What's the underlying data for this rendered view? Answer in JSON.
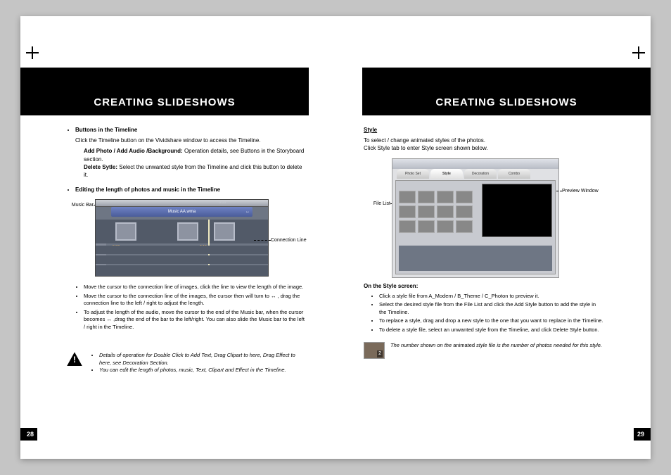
{
  "header_title": "CREATING SLIDESHOWS",
  "left": {
    "page_number": "28",
    "section1_title": "Buttons in the Timeline",
    "section1_intro": "Click the Timeline button on the Vividshare window to access the Timeline.",
    "section1_add_label": "Add Photo / Add Audio /Background:",
    "section1_add_text": " Operation details, see Buttons in the Storyboard section.",
    "section1_del_label": "Delete Sytle:",
    "section1_del_text": " Select the unwanted style from the Timeline and click this button to delete it.",
    "section2_title": "Editing the length of photos and music in the Timeline",
    "fig": {
      "music_bar_label": "Music Bar",
      "connection_label": "Connection Line",
      "music_file": "Music AA.wma",
      "time_left": "0:07",
      "time_right": "0:10",
      "time_top": "0:03"
    },
    "bullets": [
      "Move the cursor to the connection line of images, click the line to view the length of the image.",
      "Move the cursor to the connection line of the images, the cursor then will turn to ↔ , drag the connection line to the left / right to adjust the length.",
      "To adjust the length of the audio, move the cursor to the end of the Music bar, when the cursor becomes ↔ ,drag the end of the bar to the left/right. You can also slide the Music bar to the left / right in the Timeline."
    ],
    "notes": [
      "Details of operation for Double Click to Add Text, Drag Clipart to here, Drag Effect to here, see Decoration Section.",
      "You can edit the length of photos, music, Text, Clipart and Effect in the Timeline."
    ]
  },
  "right": {
    "page_number": "29",
    "style_title": "Style",
    "style_intro1": "To select / change animated styles of the photos.",
    "style_intro2": "Click Style tab to enter Style screen shown below.",
    "fig": {
      "file_list_label": "File List",
      "preview_label": "Preview Window",
      "tabs": [
        "Photo Set",
        "Style",
        "Decoration",
        "Combo"
      ]
    },
    "on_style_title": "On the Style screen:",
    "style_bullets": [
      "Click a style file from A_Modern / B_Theme / C_Photon to preview it.",
      "Select the desired style file from the File List and click the Add Style button to add the style in the Timeline.",
      "To replace a style, drag and drop a new style to the one that you want to replace in the Timeline.",
      "To delete a style file, select an unwanted style from the Timeline, and click Delete Style button."
    ],
    "thumb_note_prefix": "The number shown on the ",
    "thumb_note_mid": "animated",
    "thumb_note_suffix": " style file is the number of photos needed for this style."
  }
}
